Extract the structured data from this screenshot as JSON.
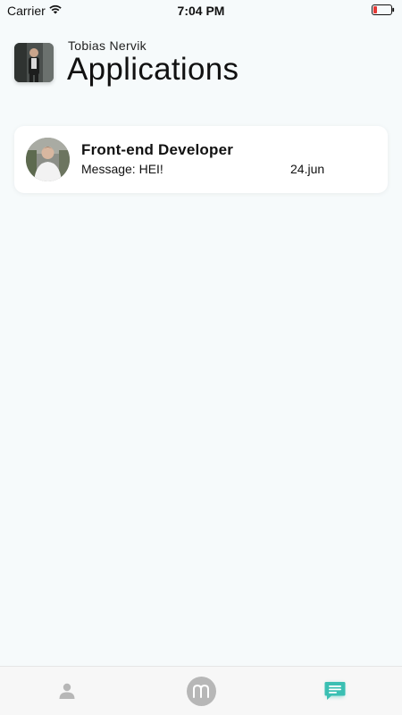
{
  "status_bar": {
    "carrier": "Carrier",
    "time": "7:04 PM"
  },
  "header": {
    "user_name": "Tobias Nervik",
    "title": "Applications"
  },
  "applications": [
    {
      "title": "Front-end Developer",
      "message": "Message: HEI!",
      "date": "24.jun"
    }
  ],
  "tab_bar": {
    "tabs": [
      {
        "icon": "person-icon",
        "active": false
      },
      {
        "icon": "m-logo-icon",
        "active": false
      },
      {
        "icon": "chat-icon",
        "active": true
      }
    ]
  },
  "colors": {
    "background": "#f6fafb",
    "accent": "#3bbfb3",
    "battery_low": "#e53935",
    "inactive_icon": "#b7b7b7"
  }
}
